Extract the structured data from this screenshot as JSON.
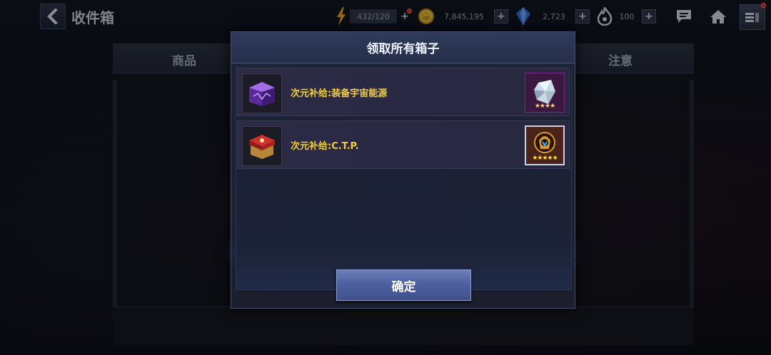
{
  "header": {
    "title": "收件箱",
    "resources": [
      {
        "name": "energy",
        "icon": "lightning-icon",
        "value": "432/120",
        "color": "#e0a21a"
      },
      {
        "name": "gold",
        "icon": "gold-coin-icon",
        "value": "7,845,195",
        "color": "#d5a52a"
      },
      {
        "name": "crystal",
        "icon": "crystal-icon",
        "value": "2,723",
        "color": "#3a7fe8"
      },
      {
        "name": "flame",
        "icon": "flame-icon",
        "value": "100",
        "color": "#cfd3dc"
      }
    ],
    "plus": "+",
    "chat_icon": "chat-icon",
    "home_icon": "home-icon",
    "menu_icon": "menu-icon"
  },
  "background_panel": {
    "column_left": "商品",
    "column_right": "注意"
  },
  "modal": {
    "title": "领取所有箱子",
    "items": [
      {
        "name": "次元补给:装备宇宙能源",
        "box_icon": "purple-box-icon",
        "reward_icon": "crystal-shard-icon",
        "reward_stars": "★★★★"
      },
      {
        "name": "次元补给:C.T.P.",
        "box_icon": "red-box-icon",
        "reward_icon": "hero-badge-icon",
        "reward_stars": "★★★★★"
      }
    ],
    "confirm_label": "确定"
  },
  "colors": {
    "item_name": "#f4cf3a",
    "accent_glow": "#3a8cff",
    "notification": "#d02b2b"
  }
}
